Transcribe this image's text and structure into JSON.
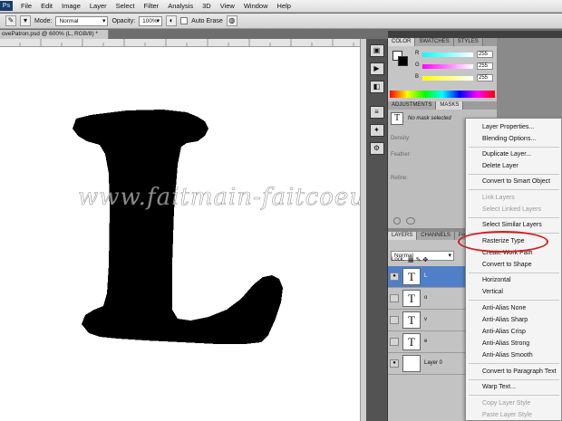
{
  "menu": [
    "File",
    "Edit",
    "Image",
    "Layer",
    "Select",
    "Filter",
    "Analysis",
    "3D",
    "View",
    "Window",
    "Help"
  ],
  "options": {
    "mode_label": "Mode:",
    "mode_value": "Normal",
    "opacity_label": "Opacity:",
    "opacity_value": "100%",
    "auto_erase_label": "Auto Erase"
  },
  "document": {
    "tab_title": "ovePatron.psd @ 600% (L, RGB/8) *",
    "letter": "L",
    "watermark": "www.faitmain-faitcoeur.fr"
  },
  "color_panel": {
    "tabs": [
      "COLOR",
      "SWATCHES",
      "STYLES"
    ],
    "r_label": "R",
    "g_label": "G",
    "b_label": "B",
    "r": "255",
    "g": "255",
    "b": "255"
  },
  "masks_panel": {
    "tabs": [
      "ADJUSTMENTS",
      "MASKS"
    ],
    "no_mask": "No mask selected",
    "density": "Density:",
    "feather": "Feather:",
    "refine": "Refine:"
  },
  "layers_panel": {
    "tabs": [
      "LAYERS",
      "CHANNELS",
      "PA"
    ],
    "blend_mode": "Normal",
    "lock_label": "Lock:",
    "layers": [
      {
        "name": "L",
        "type": "text",
        "selected": true
      },
      {
        "name": "o",
        "type": "text",
        "selected": false
      },
      {
        "name": "v",
        "type": "text",
        "selected": false
      },
      {
        "name": "e",
        "type": "text",
        "selected": false
      },
      {
        "name": "Layer 0",
        "type": "raster",
        "selected": false
      }
    ],
    "text_thumb": "T"
  },
  "context_menu": [
    {
      "label": "Layer Properties...",
      "disabled": false
    },
    {
      "label": "Blending Options...",
      "disabled": false
    },
    {
      "sep": true
    },
    {
      "label": "Duplicate Layer...",
      "disabled": false
    },
    {
      "label": "Delete Layer",
      "disabled": false
    },
    {
      "sep": true
    },
    {
      "label": "Convert to Smart Object",
      "disabled": false
    },
    {
      "sep": true
    },
    {
      "label": "Link Layers",
      "disabled": true
    },
    {
      "label": "Select Linked Layers",
      "disabled": true
    },
    {
      "sep": true
    },
    {
      "label": "Select Similar Layers",
      "disabled": false
    },
    {
      "sep": true
    },
    {
      "label": "Rasterize Type",
      "disabled": false
    },
    {
      "label": "Create Work Path",
      "disabled": false
    },
    {
      "label": "Convert to Shape",
      "disabled": false
    },
    {
      "sep": true
    },
    {
      "label": "Horizontal",
      "disabled": false
    },
    {
      "label": "Vertical",
      "disabled": false
    },
    {
      "sep": true
    },
    {
      "label": "Anti-Alias None",
      "disabled": false
    },
    {
      "label": "Anti-Alias Sharp",
      "disabled": false
    },
    {
      "label": "Anti-Alias Crisp",
      "disabled": false
    },
    {
      "label": "Anti-Alias Strong",
      "disabled": false
    },
    {
      "label": "Anti-Alias Smooth",
      "disabled": false
    },
    {
      "sep": true
    },
    {
      "label": "Convert to Paragraph Text",
      "disabled": false
    },
    {
      "sep": true
    },
    {
      "label": "Warp Text...",
      "disabled": false
    },
    {
      "sep": true
    },
    {
      "label": "Copy Layer Style",
      "disabled": true
    },
    {
      "label": "Paste Layer Style",
      "disabled": true
    }
  ],
  "colors": {
    "highlight": "#d02020",
    "selected_layer": "#4f7fc9"
  }
}
